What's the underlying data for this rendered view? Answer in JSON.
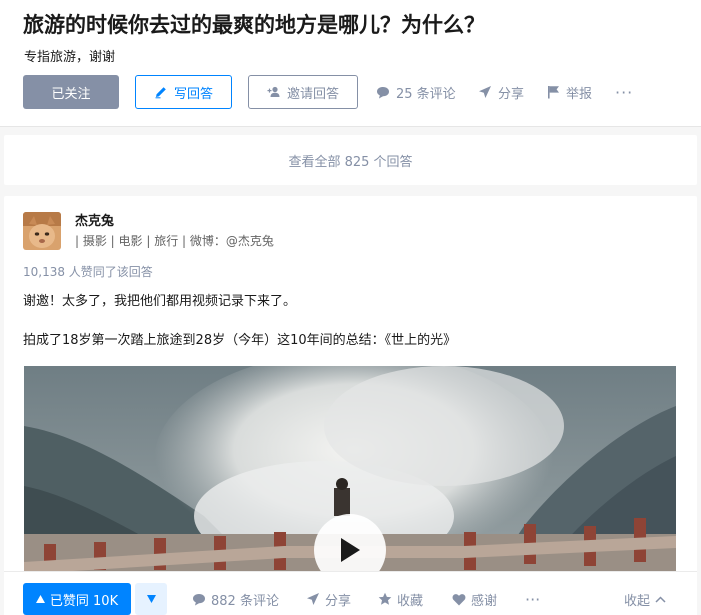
{
  "question": {
    "title": "旅游的时候你去过的最爽的地方是哪儿？为什么？",
    "detail": "专指旅游，谢谢",
    "follow_button": "已关注",
    "write_button": "写回答",
    "invite_button": "邀请回答",
    "comments": "25 条评论",
    "share": "分享",
    "report": "举报",
    "more": "···"
  },
  "view_all": "查看全部 825 个回答",
  "answer": {
    "author_name": "杰克兔",
    "author_bio": "| 摄影 | 电影 | 旅行 | 微博：@杰克兔",
    "vote_summary": "10,138 人赞同了该回答",
    "paragraphs": [
      "谢邀！太多了，我把他们都用视频记录下来了。",
      "拍成了18岁第一次踏上旅途到28岁（今年）这10年间的总结：《世上的光》"
    ]
  },
  "actions": {
    "vote_up": "已赞同 10K",
    "comments": "882 条评论",
    "share": "分享",
    "collect": "收藏",
    "thanks": "感谢",
    "more": "···",
    "collapse": "收起"
  },
  "icons": {
    "write": "pencil-icon",
    "invite": "add-person-icon",
    "comment": "comment-bubble-icon",
    "share": "paper-plane-icon",
    "report": "flag-icon",
    "collect": "star-icon",
    "thanks": "heart-icon",
    "collapse": "chevron-up-icon",
    "play": "play-icon"
  },
  "colors": {
    "accent": "#0084ff",
    "muted": "#8590a6",
    "followed_bg": "#8590a6",
    "page_bg": "#f6f6f6"
  }
}
